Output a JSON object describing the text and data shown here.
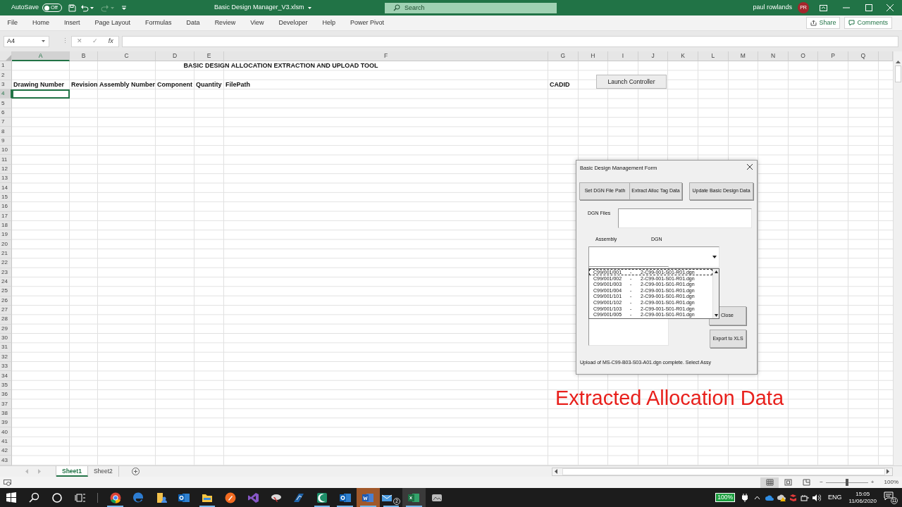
{
  "title_bar": {
    "autosave_label": "AutoSave",
    "autosave_on": false,
    "autosave_state": "Off",
    "filename": "Basic Design Manager_V3.xlsm",
    "search_placeholder": "Search",
    "user_name": "paul rowlands",
    "user_initials": "PR"
  },
  "ribbon": {
    "tabs": [
      {
        "label": "File",
        "selected": false
      },
      {
        "label": "Home",
        "selected": false
      },
      {
        "label": "Insert",
        "selected": false
      },
      {
        "label": "Page Layout",
        "selected": false
      },
      {
        "label": "Formulas",
        "selected": false
      },
      {
        "label": "Data",
        "selected": false
      },
      {
        "label": "Review",
        "selected": false
      },
      {
        "label": "View",
        "selected": false
      },
      {
        "label": "Developer",
        "selected": false
      },
      {
        "label": "Help",
        "selected": false
      },
      {
        "label": "Power Pivot",
        "selected": false
      }
    ],
    "share": "Share",
    "comments": "Comments"
  },
  "formula_bar": {
    "name_box": "A4",
    "separator": "⋮",
    "buttons": [
      "✕",
      "✓",
      "fx"
    ]
  },
  "sheet": {
    "columns": [
      {
        "label": "A",
        "selected": true
      },
      {
        "label": "B",
        "selected": false
      },
      {
        "label": "C",
        "selected": false
      },
      {
        "label": "D",
        "selected": false
      },
      {
        "label": "E",
        "selected": false
      },
      {
        "label": "F",
        "selected": false
      },
      {
        "label": "G",
        "selected": false
      },
      {
        "label": "H",
        "selected": false
      },
      {
        "label": "I",
        "selected": false
      },
      {
        "label": "J",
        "selected": false
      },
      {
        "label": "K",
        "selected": false
      },
      {
        "label": "L",
        "selected": false
      },
      {
        "label": "M",
        "selected": false
      },
      {
        "label": "N",
        "selected": false
      },
      {
        "label": "O",
        "selected": false
      },
      {
        "label": "P",
        "selected": false
      },
      {
        "label": "Q",
        "selected": false
      }
    ],
    "rows": [
      {
        "label": "1",
        "selected": false,
        "cells": [
          {
            "kind": "title",
            "text": "BASIC DESIGN ALLOCATION EXTRACTION AND UPLOAD TOOL",
            "bold": true
          }
        ]
      },
      {
        "label": "2",
        "selected": false
      },
      {
        "label": "3",
        "selected": false,
        "cells": [
          {
            "kind": "header",
            "text": "Drawing Number",
            "bold": true
          },
          {
            "kind": "header",
            "text": "Revision",
            "bold": true
          },
          {
            "kind": "header",
            "text": "Assembly Number",
            "bold": true
          },
          {
            "kind": "header",
            "text": "Component",
            "bold": true
          },
          {
            "kind": "header",
            "text": "Quantity",
            "bold": true
          },
          {
            "kind": "header",
            "text": "FilePath",
            "bold": true
          },
          {
            "kind": "header",
            "text": "CADID",
            "bold": true
          }
        ]
      },
      {
        "label": "4",
        "selected": true
      },
      {
        "label": "5",
        "selected": false
      },
      {
        "label": "6",
        "selected": false
      },
      {
        "label": "7",
        "selected": false
      },
      {
        "label": "8",
        "selected": false
      },
      {
        "label": "9",
        "selected": false
      },
      {
        "label": "10",
        "selected": false
      },
      {
        "label": "11",
        "selected": false
      },
      {
        "label": "12",
        "selected": false
      },
      {
        "label": "13",
        "selected": false
      },
      {
        "label": "14",
        "selected": false
      },
      {
        "label": "15",
        "selected": false
      },
      {
        "label": "16",
        "selected": false
      },
      {
        "label": "17",
        "selected": false
      },
      {
        "label": "18",
        "selected": false
      },
      {
        "label": "19",
        "selected": false
      },
      {
        "label": "20",
        "selected": false
      },
      {
        "label": "21",
        "selected": false
      },
      {
        "label": "22",
        "selected": false
      },
      {
        "label": "23",
        "selected": false
      },
      {
        "label": "24",
        "selected": false
      },
      {
        "label": "25",
        "selected": false
      },
      {
        "label": "26",
        "selected": false
      },
      {
        "label": "27",
        "selected": false
      },
      {
        "label": "28",
        "selected": false
      },
      {
        "label": "29",
        "selected": false
      },
      {
        "label": "30",
        "selected": false
      },
      {
        "label": "31",
        "selected": false
      },
      {
        "label": "32",
        "selected": false
      },
      {
        "label": "33",
        "selected": false
      },
      {
        "label": "34",
        "selected": false
      },
      {
        "label": "35",
        "selected": false
      },
      {
        "label": "36",
        "selected": false
      },
      {
        "label": "37",
        "selected": false
      },
      {
        "label": "38",
        "selected": false
      },
      {
        "label": "39",
        "selected": false
      },
      {
        "label": "40",
        "selected": false
      },
      {
        "label": "41",
        "selected": false
      },
      {
        "label": "42",
        "selected": false
      },
      {
        "label": "43",
        "selected": false
      }
    ],
    "launch_button": "Launch Controller"
  },
  "form": {
    "title": "Basic Design Management Form",
    "buttons": [
      "Set DGN File Path",
      "Extract Alloc Tag Data",
      "Update Basic Design Data"
    ],
    "dgn_files_label": "DGN Files",
    "assembly_label": "Assembly",
    "dgn_label": "DGN",
    "dropdown_open": true,
    "dropdown_items": [
      {
        "assembly": "C99/001/001",
        "separator": "-",
        "dgn": "2-C99-001-S01-R01.dgn",
        "selected": true
      },
      {
        "assembly": "C99/001/002",
        "separator": "-",
        "dgn": "2-C99-001-S01-R01.dgn",
        "selected": false
      },
      {
        "assembly": "C99/001/003",
        "separator": "-",
        "dgn": "2-C99-001-S01-R01.dgn",
        "selected": false
      },
      {
        "assembly": "C99/001/004",
        "separator": "-",
        "dgn": "2-C99-001-S01-R01.dgn",
        "selected": false
      },
      {
        "assembly": "C99/001/101",
        "separator": "-",
        "dgn": "2-C99-001-S01-R01.dgn",
        "selected": false
      },
      {
        "assembly": "C99/001/102",
        "separator": "-",
        "dgn": "2-C99-001-S01-R01.dgn",
        "selected": false
      },
      {
        "assembly": "C99/001/103",
        "separator": "-",
        "dgn": "2-C99-001-S01-R01.dgn",
        "selected": false
      },
      {
        "assembly": "C99/001/005",
        "separator": "-",
        "dgn": "2-C99-001-S01-R01.dgn",
        "selected": false
      }
    ],
    "close_button": "Close",
    "export_button": "Export to XLS",
    "status": "Upload of MS-C99-B03-S03-A01.dgn complete. Select Assy"
  },
  "caption": "Extracted Allocation Data",
  "sheet_tabs": [
    {
      "label": "Sheet1",
      "selected": true
    },
    {
      "label": "Sheet2",
      "selected": false
    }
  ],
  "status_bar": {
    "views": [
      {
        "kind": "normal",
        "selected": true
      },
      {
        "kind": "page_layout",
        "selected": false
      },
      {
        "kind": "page_break",
        "selected": false
      }
    ],
    "zoom_out": "−",
    "zoom_in": "+",
    "zoom": {
      "level": 0.5,
      "reading": "100%"
    }
  },
  "taskbar": {
    "apps": [
      {
        "kind": "chrome",
        "running": true
      },
      {
        "kind": "edge",
        "running": false
      },
      {
        "kind": "folder_person",
        "running": false
      },
      {
        "kind": "outlook",
        "running": false
      },
      {
        "kind": "explorer",
        "running": true
      },
      {
        "kind": "orange",
        "running": false
      },
      {
        "kind": "studio",
        "running": false
      },
      {
        "kind": "tool",
        "running": false
      },
      {
        "kind": "blue",
        "running": false
      },
      {
        "kind": "green",
        "running": true
      },
      {
        "kind": "outlook",
        "running": true
      },
      {
        "kind": "word",
        "running": true
      },
      {
        "kind": "mail",
        "running": true
      },
      {
        "kind": "excel",
        "running": true
      },
      {
        "kind": "gray",
        "running": false
      }
    ],
    "mail_badge": "2",
    "battery": "100%",
    "language": "ENG",
    "time": "15:05",
    "date": "11/06/2020",
    "notification_count": "11"
  }
}
